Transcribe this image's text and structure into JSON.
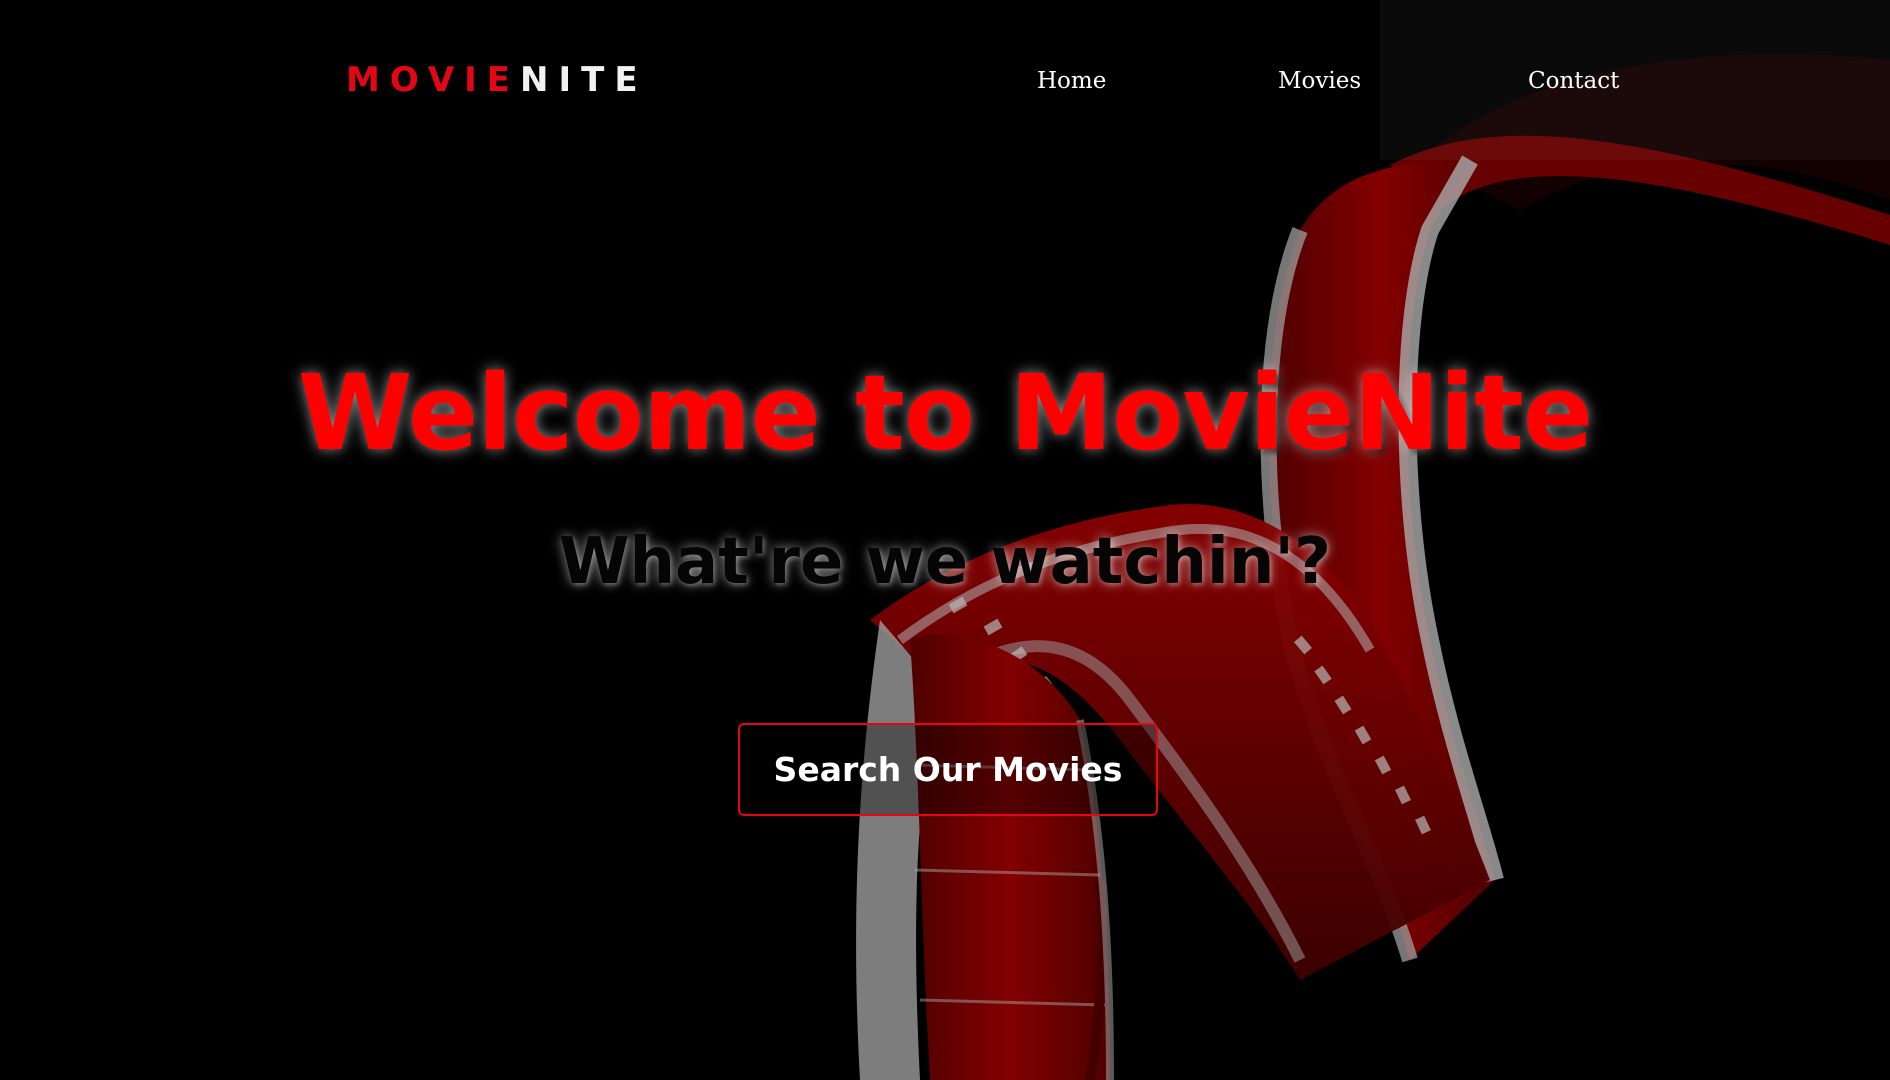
{
  "brand": {
    "part1": "MOVIE",
    "part2": "NITE",
    "accent_color": "#e30613"
  },
  "nav": {
    "items": [
      {
        "label": "Home"
      },
      {
        "label": "Movies"
      },
      {
        "label": "Contact"
      }
    ]
  },
  "hero": {
    "title": "Welcome to MovieNite",
    "subtitle": "What're we watchin'?",
    "cta_label": "Search Our Movies",
    "title_color": "#ff0000"
  },
  "background": {
    "image": "film-strip-ribbon",
    "colors": [
      "#000000",
      "#8b0000",
      "#c0c0c0"
    ]
  }
}
